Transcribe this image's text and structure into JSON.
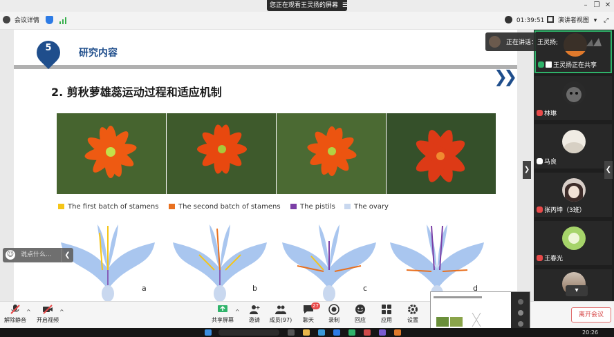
{
  "window": {
    "banner": "您正在观看王灵扬的屏幕",
    "meeting_info_label": "会议详情",
    "timer": "01:39:51",
    "view_mode_label": "演讲者视图"
  },
  "slide": {
    "section_number": "5",
    "section_title": "研究内容",
    "title": "2. 剪秋萝雄蕊运动过程和适应机制",
    "legend": [
      {
        "label": "The first batch of stamens",
        "color": "#f5c518"
      },
      {
        "label": "The second batch of stamens",
        "color": "#e8701f"
      },
      {
        "label": "The pistils",
        "color": "#7b3fa6"
      },
      {
        "label": "The ovary",
        "color": "#c9d8ef"
      }
    ],
    "diagram_labels": [
      "a",
      "b",
      "c",
      "d"
    ]
  },
  "chat_input": {
    "placeholder": "说点什么..."
  },
  "speaking": {
    "text": "正在讲话：王灵扬;"
  },
  "participants": [
    {
      "name": "王灵扬正在共享",
      "active": true
    },
    {
      "name": "林琳"
    },
    {
      "name": "马良"
    },
    {
      "name": "张丙坤（3班）"
    },
    {
      "name": "王春光"
    }
  ],
  "toolbar": {
    "mute_label": "解除静音",
    "video_label": "开启视频",
    "share_label": "共享屏幕",
    "invite_label": "邀请",
    "members_label": "成员(97)",
    "chat_label": "聊天",
    "chat_badge": "27",
    "record_label": "录制",
    "reactions_label": "回应",
    "apps_label": "应用",
    "settings_label": "设置",
    "leave_label": "离开会议"
  },
  "taskbar": {
    "clock": "20:26"
  },
  "colors": {
    "accent_blue": "#1f4e8c",
    "active_green": "#2fb36a",
    "leave_red": "#d64545"
  }
}
